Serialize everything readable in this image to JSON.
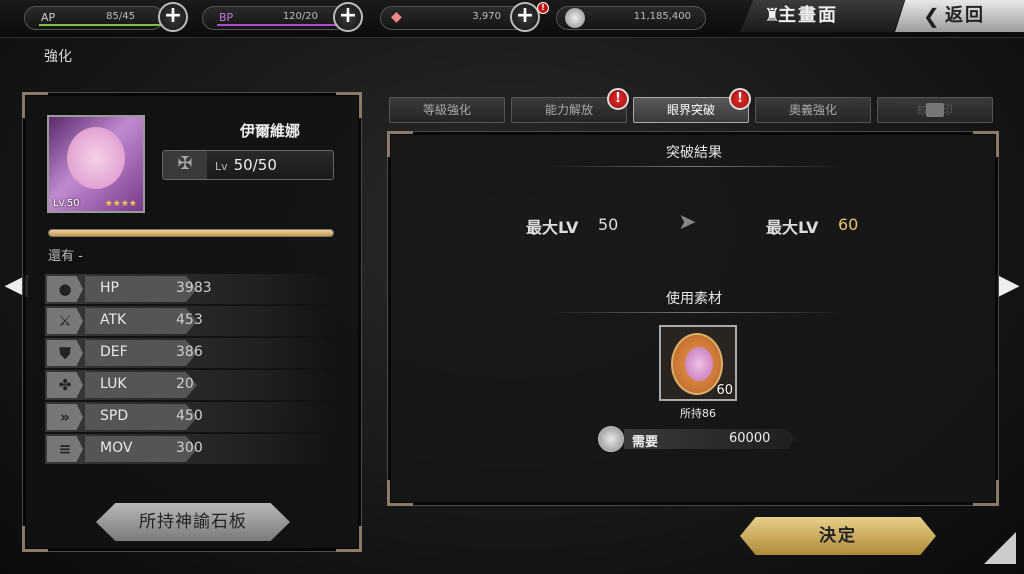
{
  "topbar": {
    "ap": {
      "label": "AP",
      "value": "85/45",
      "bar_fraction": 0.95,
      "bar_color": "#7fc24a"
    },
    "bp": {
      "label": "BP",
      "value": "120/20",
      "bar_fraction": 0.95,
      "bar_color": "#b04ad0"
    },
    "gems": {
      "value": "3,970"
    },
    "coins": {
      "value": "11,185,400"
    },
    "home_label": "主畫面",
    "back_label": "返回"
  },
  "page": {
    "title": "強化"
  },
  "character": {
    "name": "伊爾維娜",
    "level_prefix": "Lv",
    "level": "50/50",
    "portrait_level": "Lv.50",
    "portrait_stars": "★★★★",
    "exp_fraction": 1.0,
    "remain_text": "還有 -"
  },
  "stats": [
    {
      "icon": "hp-icon",
      "label": "HP",
      "value": "3983"
    },
    {
      "icon": "atk-icon",
      "label": "ATK",
      "value": "453"
    },
    {
      "icon": "def-icon",
      "label": "DEF",
      "value": "386"
    },
    {
      "icon": "luk-icon",
      "label": "LUK",
      "value": "20"
    },
    {
      "icon": "spd-icon",
      "label": "SPD",
      "value": "450"
    },
    {
      "icon": "mov-icon",
      "label": "MOV",
      "value": "300"
    }
  ],
  "slate_button_label": "所持神諭石板",
  "tabs": [
    {
      "label": "等級強化",
      "state": "normal"
    },
    {
      "label": "能力解放",
      "state": "normal",
      "alert": "!"
    },
    {
      "label": "眼界突破",
      "state": "active",
      "alert": "!"
    },
    {
      "label": "奧義強化",
      "state": "normal"
    },
    {
      "label": "紋　印",
      "state": "disabled"
    }
  ],
  "breakthrough": {
    "result_header": "突破結果",
    "before_label": "最大LV",
    "before_value": "50",
    "after_label": "最大LV",
    "after_value": "60",
    "materials_header": "使用素材",
    "material_qty": "60",
    "owned_text": "所持86",
    "cost_label": "需要",
    "cost_value": "60000"
  },
  "confirm_label": "決定",
  "colors": {
    "accent_gold": "#e6c36a",
    "alert_red": "#c01818"
  }
}
